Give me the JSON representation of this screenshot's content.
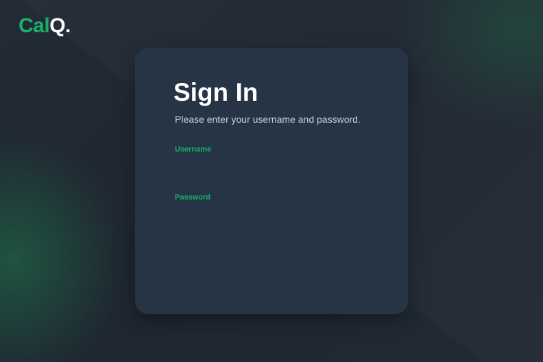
{
  "brand": {
    "logo_accent": "Cal",
    "logo_rest": "Q.",
    "accent_color": "#17b26a",
    "background_color": "#202934",
    "card_color": "#263446"
  },
  "signin": {
    "title": "Sign In",
    "subtitle": "Please enter your username and password.",
    "username_label": "Username",
    "username_value": "",
    "password_label": "Password",
    "password_value": ""
  }
}
